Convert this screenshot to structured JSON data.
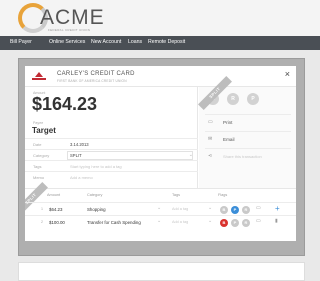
{
  "brand": {
    "name": "ACME",
    "tagline": "FEDERAL CREDIT UNION",
    "ring_color": "#e8a33a"
  },
  "nav": {
    "items": [
      "Bill Payer",
      "Online Services",
      "New Account",
      "Loans",
      "Remote Deposit"
    ]
  },
  "modal": {
    "account_name": "CARLEY'S CREDIT CARD",
    "account_sub": "FIRST BANK OF AMERICA CREDIT UNION",
    "close_glyph": "×",
    "amount_label": "Amount",
    "amount": "$164.23",
    "payee_label": "Payee",
    "payee": "Target",
    "fields": {
      "date_label": "Date",
      "date_value": "3.14.2013",
      "category_label": "Category",
      "category_value": "SPLIT",
      "tags_label": "Tags",
      "tags_placeholder": "Start typing here to add a tag",
      "memo_label": "Memo",
      "memo_placeholder": "Add a memo"
    },
    "split_ribbon": "SPLIT",
    "split_ribbon_left": "SPLIT",
    "flag_letters": [
      "B",
      "R",
      "P"
    ],
    "actions": {
      "print": "Print",
      "email": "Email",
      "share": "Share this transaction"
    },
    "split_table": {
      "headers": [
        "Amount",
        "Category",
        "Tags",
        "Flags"
      ],
      "tag_placeholder": "Add a tag",
      "rows": [
        {
          "index": "1",
          "amount": "$64.23",
          "category": "Shopping",
          "flags": [
            "B",
            "P",
            "R"
          ]
        },
        {
          "index": "2",
          "amount": "$100.00",
          "category": "Transfer for Cash Spending",
          "flags": [
            "B",
            "P",
            "R"
          ]
        }
      ],
      "colors": {
        "blue": "#3b8ed8",
        "red": "#d9322e",
        "grey": "#c9c9c9"
      }
    }
  }
}
